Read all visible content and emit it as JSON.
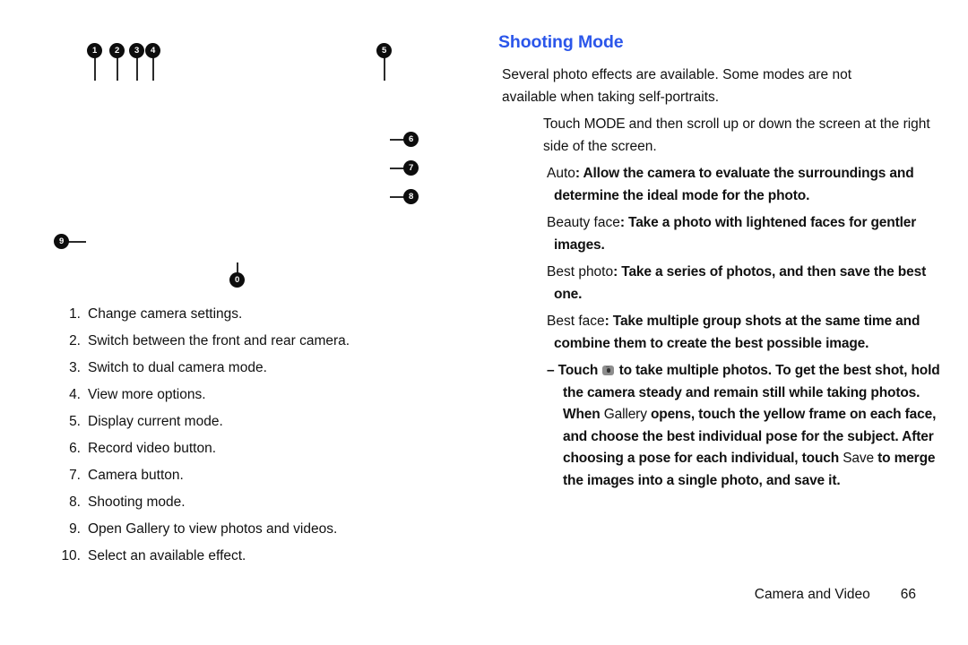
{
  "page": {
    "footer_label": "Camera and Video",
    "footer_page_number": "66"
  },
  "accent_color": "#2b56ea",
  "callouts": [
    {
      "id": "1",
      "label": "1"
    },
    {
      "id": "2",
      "label": "2"
    },
    {
      "id": "3",
      "label": "3"
    },
    {
      "id": "4",
      "label": "4"
    },
    {
      "id": "5",
      "label": "5"
    },
    {
      "id": "6",
      "label": "6"
    },
    {
      "id": "7",
      "label": "7"
    },
    {
      "id": "8",
      "label": "8"
    },
    {
      "id": "9",
      "label": "9"
    },
    {
      "id": "10",
      "label": "0"
    }
  ],
  "legend": {
    "items": [
      {
        "number": "1.",
        "text": "Change camera settings."
      },
      {
        "number": "2.",
        "text": "Switch between the front and rear camera."
      },
      {
        "number": "3.",
        "text": "Switch to dual camera mode."
      },
      {
        "number": "4.",
        "text": "View more options."
      },
      {
        "number": "5.",
        "text": "Display current mode."
      },
      {
        "number": "6.",
        "text": "Record video button."
      },
      {
        "number": "7.",
        "text": "Camera button."
      },
      {
        "number": "8.",
        "text": "Shooting mode."
      },
      {
        "number": "9.",
        "text": "Open Gallery to view photos and videos."
      },
      {
        "number": "10.",
        "text": "Select an available effect."
      }
    ]
  },
  "section": {
    "title": "Shooting Mode",
    "intro": "Several photo effects are available. Some modes are not available when taking self-portraits.",
    "instruction_pre": "Touch ",
    "instruction_mode": "MODE",
    "instruction_post": " and then scroll up or down the screen at the right side of the screen.",
    "modes": [
      {
        "name": "Auto",
        "separator": ":",
        "description": " Allow the camera to evaluate the surroundings and determine the ideal mode for the photo."
      },
      {
        "name": "Beauty face",
        "separator": ":",
        "description": " Take a photo with lightened faces for gentler images."
      },
      {
        "name": "Best photo",
        "separator": ":",
        "description": " Take a series of photos, and then save the best one."
      },
      {
        "name": "Best face",
        "separator": ":",
        "description": " Take multiple group shots at the same time and combine them to create the best possible image."
      }
    ],
    "sub_bullet": {
      "dash": "–",
      "part1": "Touch ",
      "icon": "camera-icon",
      "part2": " to take multiple photos. To get the best shot, hold the camera steady and remain still while taking photos. When ",
      "emphasis1": "Gallery",
      "part3": " opens, touch the yellow frame on each face, and choose the best individual pose for the subject. After choosing a pose for each individual, touch ",
      "emphasis2": "Save",
      "part4": " to merge the images into a single photo, and save it."
    }
  }
}
